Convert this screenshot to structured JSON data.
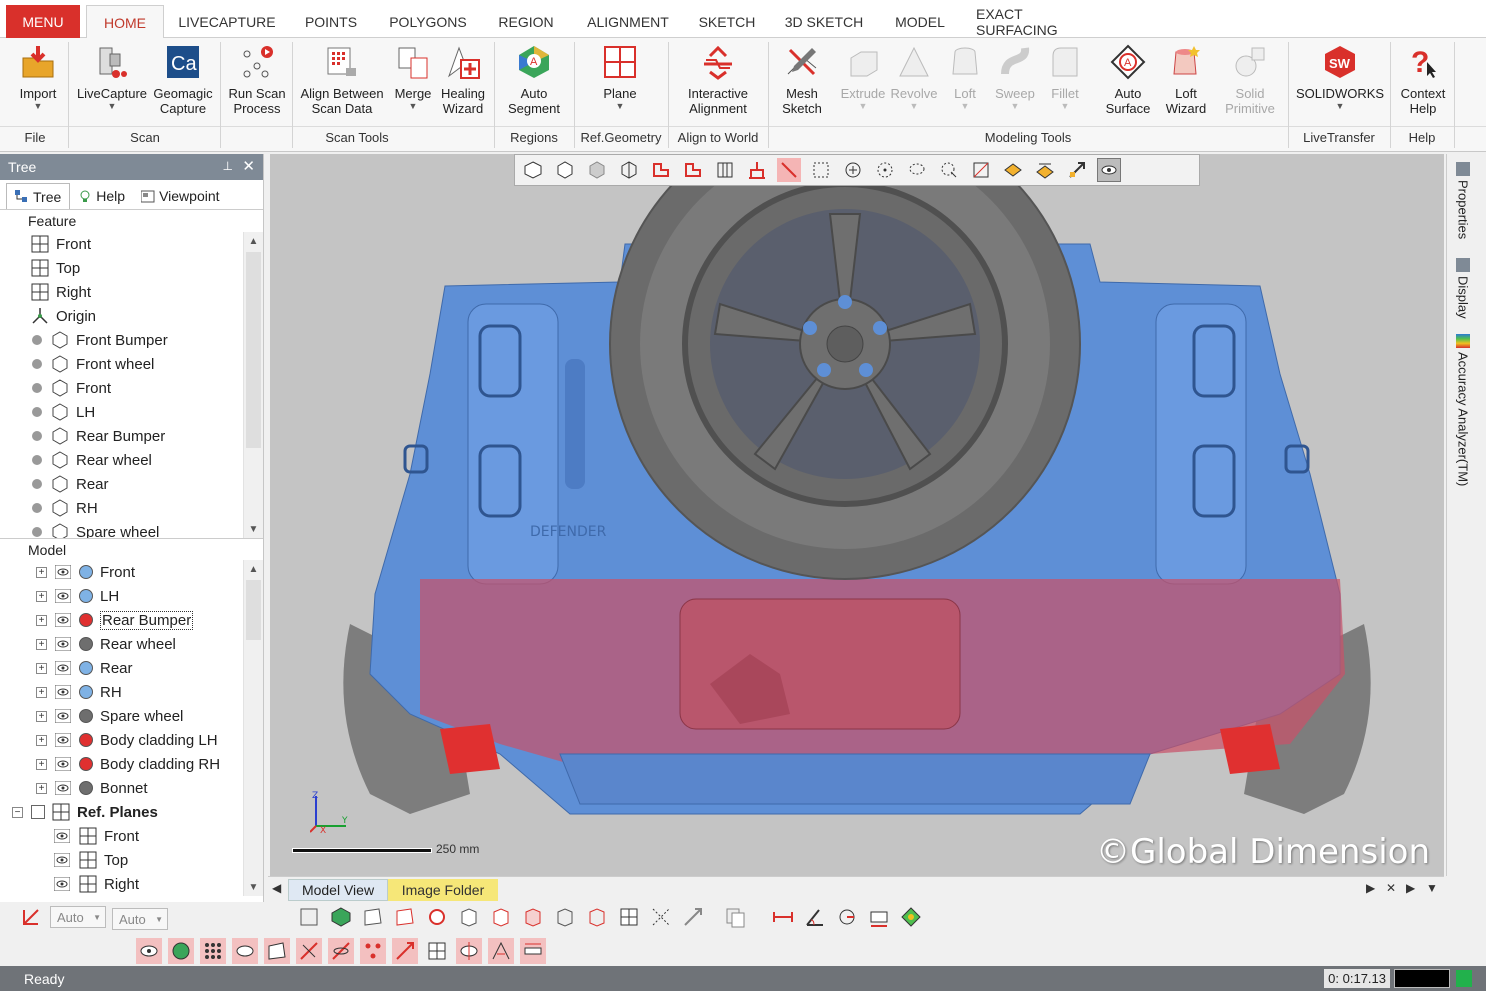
{
  "app": {
    "menu_label": "MENU",
    "tabs": [
      {
        "label": "HOME",
        "active": true
      },
      {
        "label": "LIVECAPTURE"
      },
      {
        "label": "POINTS"
      },
      {
        "label": "POLYGONS"
      },
      {
        "label": "REGION"
      },
      {
        "label": "ALIGNMENT"
      },
      {
        "label": "SKETCH"
      },
      {
        "label": "3D SKETCH"
      },
      {
        "label": "MODEL"
      },
      {
        "label": "EXACT SURFACING"
      }
    ]
  },
  "ribbon": {
    "buttons": {
      "import": {
        "l1": "Import",
        "l2": ""
      },
      "livecapture": {
        "l1": "LiveCapture",
        "l2": ""
      },
      "geomagic": {
        "l1": "Geomagic",
        "l2": "Capture"
      },
      "runscan": {
        "l1": "Run Scan",
        "l2": "Process"
      },
      "alignbetween": {
        "l1": "Align Between",
        "l2": "Scan Data"
      },
      "merge": {
        "l1": "Merge",
        "l2": ""
      },
      "healing": {
        "l1": "Healing",
        "l2": "Wizard"
      },
      "autoseg": {
        "l1": "Auto",
        "l2": "Segment"
      },
      "plane": {
        "l1": "Plane",
        "l2": ""
      },
      "interactive": {
        "l1": "Interactive",
        "l2": "Alignment"
      },
      "meshsketch": {
        "l1": "Mesh",
        "l2": "Sketch"
      },
      "extrude": {
        "l1": "Extrude",
        "l2": ""
      },
      "revolve": {
        "l1": "Revolve",
        "l2": ""
      },
      "loft": {
        "l1": "Loft",
        "l2": ""
      },
      "sweep": {
        "l1": "Sweep",
        "l2": ""
      },
      "fillet": {
        "l1": "Fillet",
        "l2": ""
      },
      "autosurface": {
        "l1": "Auto",
        "l2": "Surface"
      },
      "loftwizard": {
        "l1": "Loft",
        "l2": "Wizard"
      },
      "solidprim": {
        "l1": "Solid",
        "l2": "Primitive"
      },
      "solidworks": {
        "l1": "SOLIDWORKS",
        "l2": ""
      },
      "contexthelp": {
        "l1": "Context",
        "l2": "Help"
      }
    },
    "groups": {
      "file": "File",
      "scan": "Scan",
      "scantools": "Scan Tools",
      "regions": "Regions",
      "refgeom": "Ref.Geometry",
      "alignworld": "Align to World",
      "modeling": "Modeling Tools",
      "livetransfer": "LiveTransfer",
      "help": "Help"
    }
  },
  "panel": {
    "title": "Tree",
    "tabs": [
      "Tree",
      "Help",
      "Viewpoint"
    ],
    "feature_header": "Feature",
    "model_header": "Model",
    "features": [
      "Front",
      "Top",
      "Right",
      "Origin",
      "Front Bumper",
      "Front wheel",
      "Front",
      "LH",
      "Rear Bumper",
      "Rear wheel",
      "Rear",
      "RH",
      "Spare wheel"
    ],
    "models": [
      {
        "label": "Front",
        "color": "#7fb2e5"
      },
      {
        "label": "LH",
        "color": "#7fb2e5"
      },
      {
        "label": "Rear Bumper",
        "color": "#e03030",
        "selected": true
      },
      {
        "label": "Rear wheel",
        "color": "#6e6e6e"
      },
      {
        "label": "Rear",
        "color": "#7fb2e5"
      },
      {
        "label": "RH",
        "color": "#7fb2e5"
      },
      {
        "label": "Spare wheel",
        "color": "#6e6e6e"
      },
      {
        "label": "Body cladding LH",
        "color": "#e03030"
      },
      {
        "label": "Body cladding RH",
        "color": "#e03030"
      },
      {
        "label": "Bonnet",
        "color": "#6e6e6e"
      }
    ],
    "refplanes_label": "Ref. Planes",
    "refplanes": [
      "Front",
      "Top",
      "Right"
    ]
  },
  "viewport": {
    "watermark": "©Global Dimension",
    "scale_label": "250 mm",
    "badge_text": "DEFENDER"
  },
  "right_dock": [
    "Properties",
    "Display",
    "Accuracy Analyzer(TM)"
  ],
  "view_tabs": {
    "model_view": "Model View",
    "image_folder": "Image Folder"
  },
  "bottom": {
    "combo1": "Auto",
    "combo2": "Auto"
  },
  "status": {
    "text": "Ready",
    "timer": "0: 0:17.13"
  },
  "colors": {
    "brand_red": "#d9302b",
    "body_blue": "#5e8fd6",
    "bumper_red": "#c8526a",
    "wheel_gray": "#6b6b6b"
  }
}
